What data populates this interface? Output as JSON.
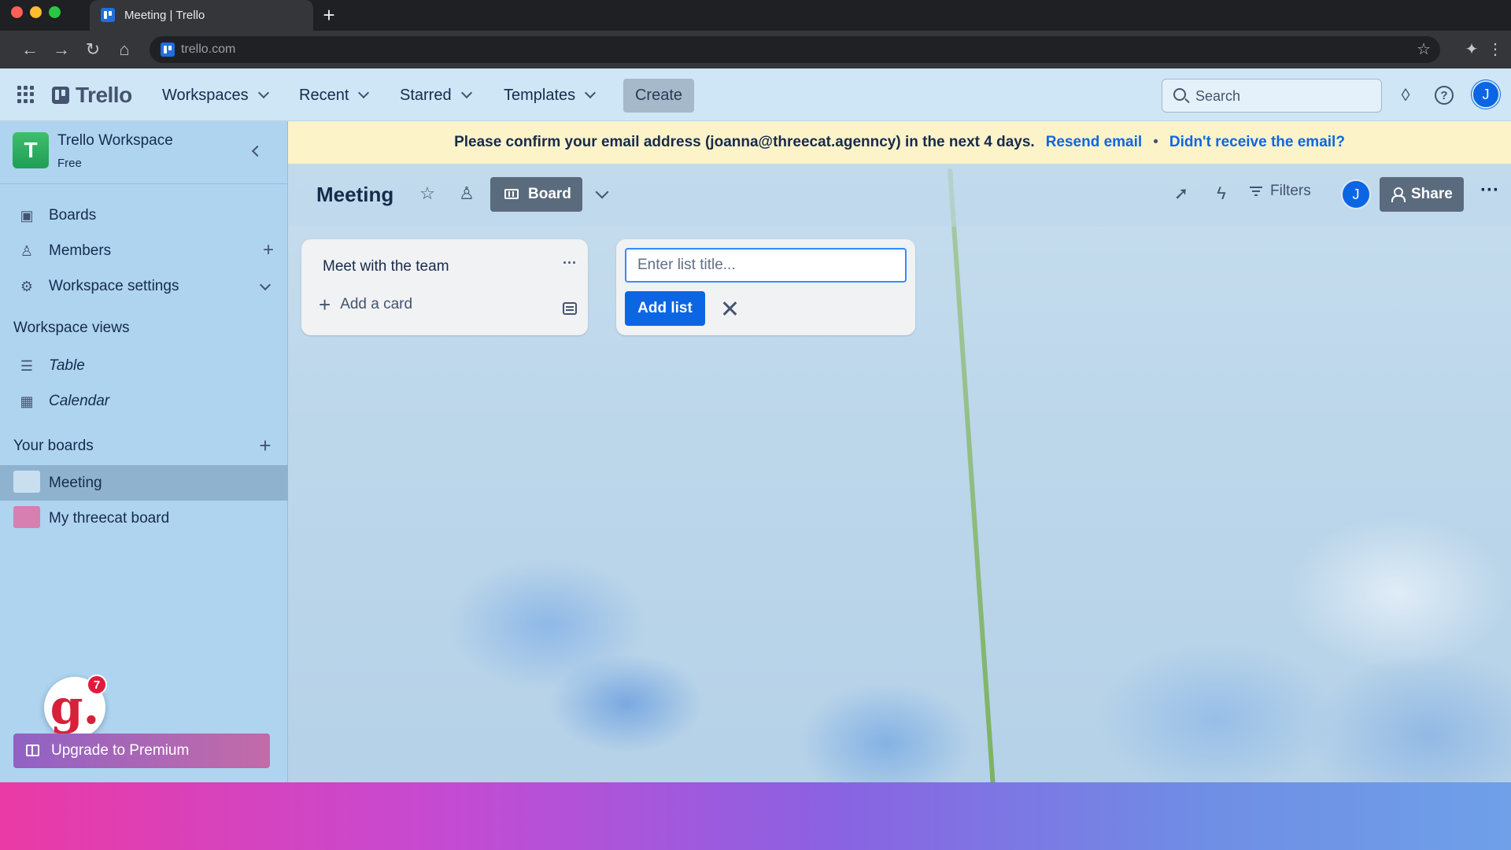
{
  "browser": {
    "tab_title": "Meeting | Trello",
    "url": "trello.com",
    "new_tab": "+"
  },
  "header": {
    "logo": "Trello",
    "nav": [
      {
        "label": "Workspaces"
      },
      {
        "label": "Recent"
      },
      {
        "label": "Starred"
      },
      {
        "label": "Templates"
      }
    ],
    "create_label": "Create",
    "search_placeholder": "Search",
    "avatar_initial": "J"
  },
  "sidebar": {
    "workspace_initial": "T",
    "workspace_name": "Trello Workspace",
    "workspace_plan": "Free",
    "items": [
      {
        "label": "Boards"
      },
      {
        "label": "Members"
      },
      {
        "label": "Workspace settings"
      }
    ],
    "views_heading": "Workspace views",
    "views": [
      {
        "label": "Table"
      },
      {
        "label": "Calendar"
      }
    ],
    "boards_heading": "Your boards",
    "boards": [
      {
        "label": "Meeting",
        "color": "#c9dff0"
      },
      {
        "label": "My threecat board",
        "color": "#d77fb0"
      }
    ],
    "badge_letter": "g.",
    "badge_count": "7",
    "upgrade_label": "Upgrade to Premium"
  },
  "banner": {
    "message": "Please confirm your email address (joanna@threecat.agenncy) in the next 4 days.",
    "resend": "Resend email",
    "separator": "•",
    "not_received": "Didn't receive the email?"
  },
  "board": {
    "title": "Meeting",
    "view_label": "Board",
    "filters_label": "Filters",
    "avatar_initial": "J",
    "share_label": "Share",
    "more": "···"
  },
  "lists": [
    {
      "title": "Meet with the team",
      "add_card_label": "Add a card",
      "more": "···"
    }
  ],
  "add_list": {
    "placeholder": "Enter list title...",
    "button_label": "Add list"
  },
  "colors": {
    "accent": "#0c66e4",
    "header_bg": "#cfe6f6",
    "sidebar_bg": "#aed4f0",
    "banner_bg": "#fdf3c8"
  }
}
